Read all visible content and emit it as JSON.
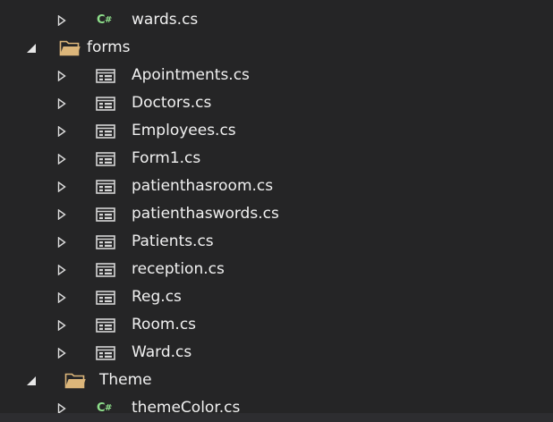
{
  "colors": {
    "background": "#252526",
    "text": "#f1f1f1",
    "folder": "#dcb67a",
    "csharp": "#8ee08b",
    "form_icon": "#d6d6d6"
  },
  "tree": [
    {
      "type": "csfile",
      "label": "wards.cs",
      "expander": "collapsed",
      "icon": "csharp-file-icon"
    },
    {
      "type": "folder",
      "label": "forms",
      "expander": "expanded",
      "icon": "folder-open-icon"
    },
    {
      "type": "form",
      "label": "Apointments.cs",
      "expander": "collapsed",
      "icon": "form-icon"
    },
    {
      "type": "form",
      "label": "Doctors.cs",
      "expander": "collapsed",
      "icon": "form-icon"
    },
    {
      "type": "form",
      "label": "Employees.cs",
      "expander": "collapsed",
      "icon": "form-icon"
    },
    {
      "type": "form",
      "label": "Form1.cs",
      "expander": "collapsed",
      "icon": "form-icon"
    },
    {
      "type": "form",
      "label": "patienthasroom.cs",
      "expander": "collapsed",
      "icon": "form-icon"
    },
    {
      "type": "form",
      "label": "patienthaswords.cs",
      "expander": "collapsed",
      "icon": "form-icon"
    },
    {
      "type": "form",
      "label": "Patients.cs",
      "expander": "collapsed",
      "icon": "form-icon"
    },
    {
      "type": "form",
      "label": "reception.cs",
      "expander": "collapsed",
      "icon": "form-icon"
    },
    {
      "type": "form",
      "label": "Reg.cs",
      "expander": "collapsed",
      "icon": "form-icon"
    },
    {
      "type": "form",
      "label": "Room.cs",
      "expander": "collapsed",
      "icon": "form-icon"
    },
    {
      "type": "form",
      "label": "Ward.cs",
      "expander": "collapsed",
      "icon": "form-icon"
    },
    {
      "type": "folder",
      "label": "Theme",
      "expander": "expanded",
      "icon": "folder-open-icon"
    },
    {
      "type": "csfile",
      "label": "themeColor.cs",
      "expander": "collapsed",
      "icon": "csharp-file-icon"
    }
  ]
}
